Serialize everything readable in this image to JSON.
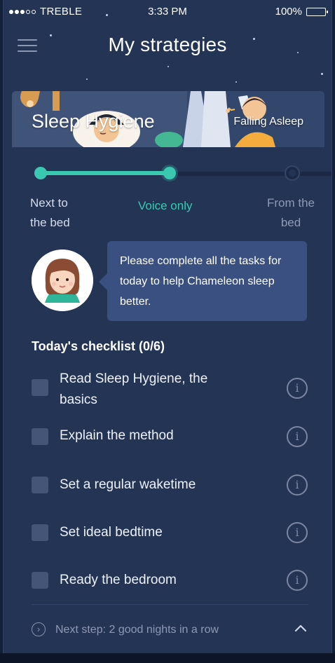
{
  "status_bar": {
    "carrier": "TREBLE",
    "time": "3:33 PM",
    "battery": "100%"
  },
  "header": {
    "title": "My strategies",
    "menu_icon": "hamburger-menu-icon"
  },
  "strategy_banner": {
    "title": "Sleep Hygiene",
    "next_strategy": "Falling Asleep"
  },
  "progress": {
    "completed_fraction": 0.5,
    "steps": [
      {
        "line1": "Next to",
        "line2": "the bed",
        "state": "done"
      },
      {
        "line1": "Voice only",
        "line2": "",
        "state": "current"
      },
      {
        "line1": "From the",
        "line2": "bed",
        "state": "todo"
      }
    ]
  },
  "coach": {
    "avatar_icon": "woman-avatar-icon",
    "message": "Please complete all the tasks for today to help Chameleon sleep better.",
    "message_lines": [
      "Please complete all the tasks for",
      "today to help Chameleon sleep",
      "better."
    ]
  },
  "checklist": {
    "title": "Today's checklist (0/6)",
    "items": [
      {
        "label": "Read Sleep Hygiene, the basics",
        "label_lines": [
          "Read Sleep Hygiene, the",
          "basics"
        ],
        "checked": false,
        "info_icon": "info-icon"
      },
      {
        "label": "Explain the method",
        "label_lines": [
          "Explain the method"
        ],
        "checked": false,
        "info_icon": "info-icon"
      },
      {
        "label": "Set a regular waketime",
        "label_lines": [
          "Set a regular waketime"
        ],
        "checked": false,
        "info_icon": "info-icon"
      },
      {
        "label": "Set ideal bedtime",
        "label_lines": [
          "Set ideal bedtime"
        ],
        "checked": false,
        "info_icon": "info-icon"
      },
      {
        "label": "Ready the bedroom",
        "label_lines": [
          "Ready the bedroom"
        ],
        "checked": false,
        "info_icon": "info-icon"
      }
    ]
  },
  "footer": {
    "next_step": "Next step: 2 good nights in a row",
    "arrow_icon": "arrow-right-circle-icon",
    "expand_icon": "chevron-up-icon"
  },
  "colors": {
    "background": "#243455",
    "accent": "#3ac9b0",
    "bubble": "#3a5080",
    "checkbox": "#445578"
  }
}
